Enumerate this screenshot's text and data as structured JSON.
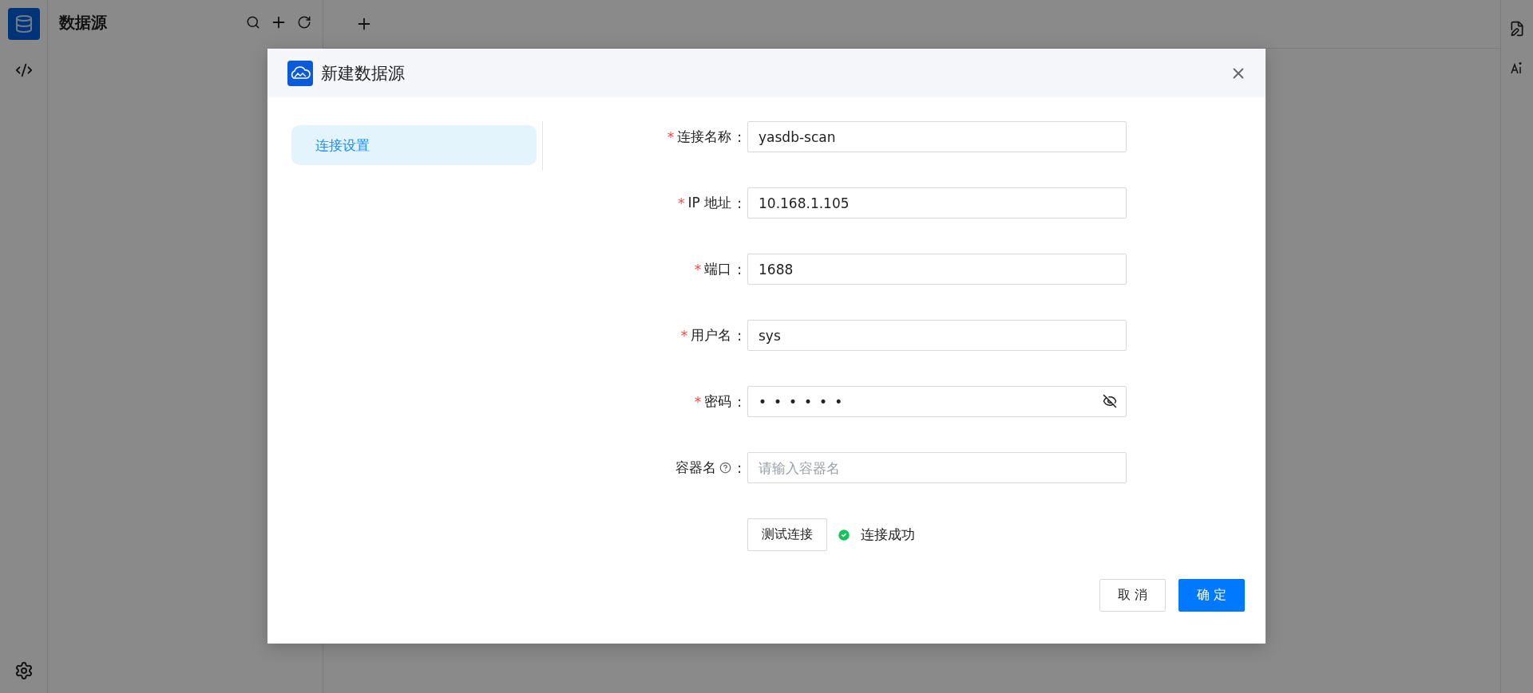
{
  "rail": {
    "items": [
      {
        "kind": "database",
        "selected": true
      },
      {
        "kind": "code",
        "selected": false
      }
    ]
  },
  "sidebar": {
    "title": "数据源"
  },
  "dialog": {
    "title": "新建数据源",
    "nav": [
      {
        "label": "连接设置",
        "selected": true
      }
    ],
    "fields": [
      {
        "label": "连接名称",
        "required_mark": "*",
        "colon": ":",
        "kind": "text",
        "value": "yasdb-scan"
      },
      {
        "label": "IP 地址",
        "required_mark": "*",
        "colon": ":",
        "kind": "text",
        "value": "10.168.1.105"
      },
      {
        "label": "端口",
        "required_mark": "*",
        "colon": ":",
        "kind": "text",
        "value": "1688"
      },
      {
        "label": "用户名",
        "required_mark": "*",
        "colon": ":",
        "kind": "text",
        "value": "sys"
      },
      {
        "label": "密码",
        "required_mark": "*",
        "colon": ":",
        "kind": "password",
        "value": "••••••"
      },
      {
        "label": "容器名",
        "colon": ":",
        "kind": "help",
        "placeholder": "请输入容器名"
      }
    ],
    "test": {
      "button": "测试连接",
      "status": "连接成功",
      "success": true
    },
    "buttons": [
      {
        "label": "取 消",
        "kind": "secondary"
      },
      {
        "label": "确 定",
        "kind": "primary"
      }
    ]
  }
}
